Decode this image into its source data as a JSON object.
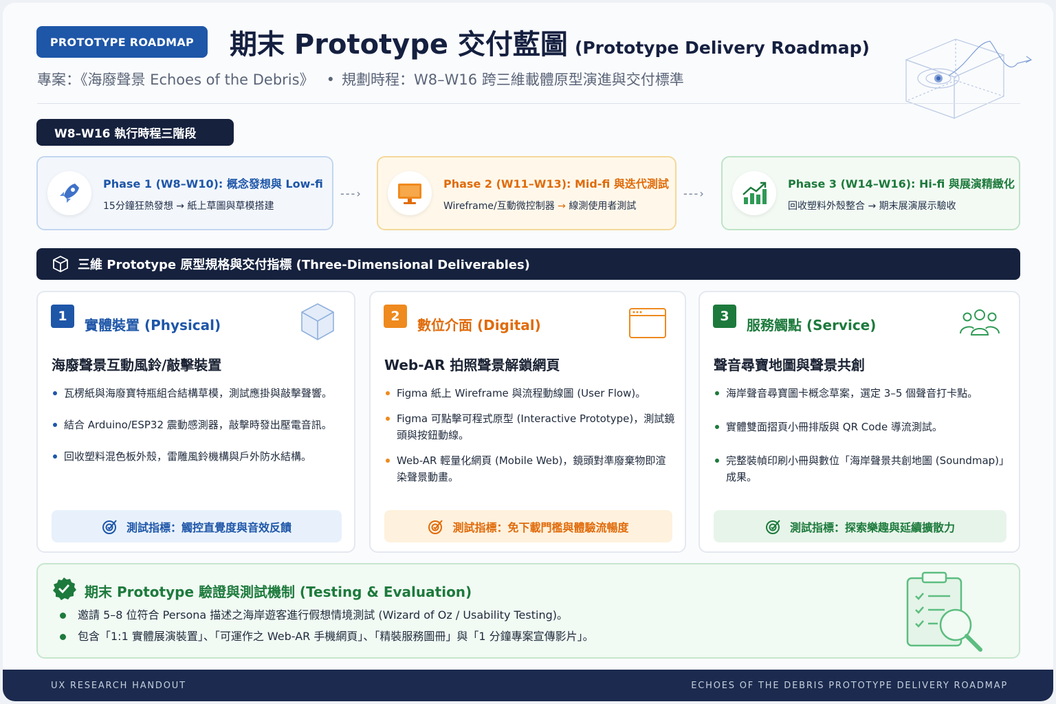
{
  "header": {
    "badge": "PROTOTYPE ROADMAP",
    "title": "期末 Prototype 交付藍圖",
    "title_sub": "(Prototype Delivery Roadmap)",
    "project": "專案：《海廢聲景 Echoes of the Debris》",
    "schedule": "規劃時程：W8–W16 跨三維載體原型演進與交付標準"
  },
  "timeline": {
    "label": "W8–W16 執行時程三階段",
    "phases": [
      {
        "title": "Phase 1 (W8–W10): 概念發想與 Low-fi",
        "desc": "15分鐘狂熱發想 → 紙上草圖與草模搭建",
        "icon": "rocket-icon",
        "color": "#1e56a8"
      },
      {
        "title": "Phase 2 (W11–W13): Mid-fi 與迭代測試",
        "desc": "Wireframe/互動微控制器 → 線測使用者測試",
        "icon": "monitor-icon",
        "color": "#e06b0a"
      },
      {
        "title": "Phase 3 (W14–W16): Hi-fi 與展演精緻化",
        "desc": "回收塑料外殼整合 → 期末展演展示驗收",
        "icon": "growth-chart-icon",
        "color": "#1d7a3c"
      }
    ]
  },
  "deliverables": {
    "label": "三維 Prototype 原型規格與交付指標 (Three-Dimensional Deliverables)",
    "cards": [
      {
        "num": "1",
        "title": "實體裝置 (Physical)",
        "heading": "海廢聲景互動風鈴/敲擊裝置",
        "bullets": [
          "瓦楞紙與海廢寶特瓶組合結構草模，測試應掛與敲擊聲響。",
          "結合 Arduino/ESP32 震動感測器，敲擊時發出壓電音訊。",
          "回收塑料混色板外殼，雷雕風鈴機構與戶外防水結構。"
        ],
        "metric": "測試指標：觸控直覺度與音效反饋",
        "icon": "cube-icon",
        "color": "#1e56a8"
      },
      {
        "num": "2",
        "title": "數位介面 (Digital)",
        "heading": "Web-AR 拍照聲景解鎖網頁",
        "bullets": [
          "Figma 紙上 Wireframe 與流程動線圖 (User Flow)。",
          "Figma 可點擊可程式原型 (Interactive Prototype)，測試鏡頭與按鈕動線。",
          "Web-AR 輕量化網頁 (Mobile Web)，鏡頭對準廢棄物即渲染聲景動畫。"
        ],
        "metric": "測試指標：免下載門檻與體驗流暢度",
        "icon": "browser-window-icon",
        "color": "#e06b0a"
      },
      {
        "num": "3",
        "title": "服務觸點 (Service)",
        "heading": "聲音尋寶地圖與聲景共創",
        "bullets": [
          "海岸聲音尋寶圖卡概念草案，選定 3–5 個聲音打卡點。",
          "實體雙面摺頁小冊排版與 QR Code 導流測試。",
          "完整裝幀印刷小冊與數位「海岸聲景共創地圖 (Soundmap)」成果。"
        ],
        "metric": "測試指標：探索樂趣與延續擴散力",
        "icon": "users-group-icon",
        "color": "#1d7a3c"
      }
    ]
  },
  "testing": {
    "title": "期末 Prototype 驗證與測試機制 (Testing & Evaluation)",
    "bullets": [
      "邀請 5–8 位符合 Persona 描述之海岸遊客進行假想情境測試 (Wizard of Oz / Usability Testing)。",
      "包含「1:1 實體展演裝置」、「可運作之 Web-AR 手機網頁」、「精裝服務圖冊」與「1 分鐘專案宣傳影片」。"
    ],
    "icon": "checklist-magnifier-icon"
  },
  "footer": {
    "left": "UX RESEARCH HANDOUT",
    "right": "ECHOES OF THE DEBRIS PROTOTYPE DELIVERY ROADMAP"
  }
}
